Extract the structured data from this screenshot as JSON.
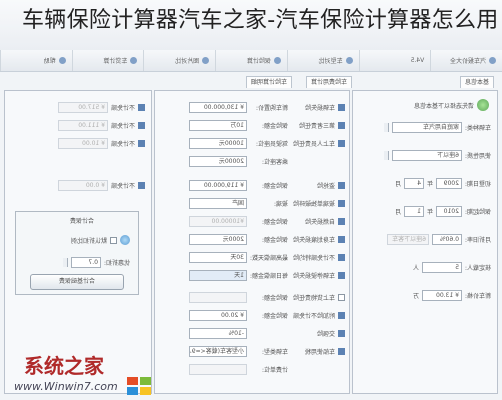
{
  "headline": "车辆保险计算器汽车之家-汽车保险计算器怎么用",
  "window": {
    "title": "车辆保险计算器"
  },
  "toolbar": {
    "items": [
      "汽车报价大全",
      "V4.5",
      "车型对比",
      "保险计算",
      "图片对比",
      "车贷计算",
      "帮助"
    ]
  },
  "tabs": {
    "left": "车险计算明细",
    "middle": "车险费用计算",
    "right": "基本信息"
  },
  "right_panel": {
    "header": "请先选择以下基本信息",
    "fields": [
      {
        "label": "车辆种类:",
        "value": "家庭自用汽车"
      },
      {
        "label": "使用性质:",
        "value": "6座以下"
      },
      {
        "label": "初登日期:",
        "value": "2009",
        "unit": "年",
        "month": "4",
        "month_unit": "月"
      },
      {
        "label": "保险起期:",
        "value": "2010",
        "unit": "年",
        "month": "1",
        "month_unit": "月"
      },
      {
        "label": "月折旧率:",
        "value": "0.60%",
        "extra": "6座以下客车"
      },
      {
        "label": "核定载人:",
        "value": "5",
        "unit": "人"
      },
      {
        "label": "新车价格:",
        "value": "¥ 13.00",
        "unit": "万"
      }
    ]
  },
  "middle_panel": {
    "rows": [
      {
        "label": "车辆损失险",
        "field_label": "新车购置价:",
        "value": "¥ 130,000.00"
      },
      {
        "label": "第三者责任险",
        "field_label": "保险金额:",
        "value": "10万"
      },
      {
        "label": "车上人员责任险",
        "field_label": "驾驶员座位:",
        "value": "10000元"
      },
      {
        "label": "",
        "field_label": "乘客座位:",
        "value": "20000元"
      },
      {
        "label": "盗抢险",
        "field_label": "保险金额:",
        "value": "¥ 119,000.00"
      },
      {
        "label": "玻璃单独破碎险",
        "field_label": "玻璃:",
        "value": "国产"
      },
      {
        "label": "自燃损失险",
        "field_label": "保险金额:",
        "value": "¥10000.00"
      },
      {
        "label": "车身划痕损失险",
        "field_label": "保险金额:",
        "value": "2000元"
      },
      {
        "label": "不计免赔特约险",
        "field_label": "最高赔偿天数:",
        "value": "30天"
      },
      {
        "label": "车辆停驶损失险",
        "field_label": "每日赔偿金额:",
        "value": "1天"
      },
      {
        "label": "车上货物责任险",
        "field_label": "保险金额:",
        "value": ""
      },
      {
        "label": "附加险不计免赔",
        "field_label": "保险金额:",
        "value": "¥ 20.00"
      },
      {
        "label": "交强险",
        "field_label": "",
        "value": "-10%"
      },
      {
        "label": "车船使用税",
        "field_label": "车辆类型:",
        "value": "小型客车(载客<=9人)"
      },
      {
        "label": "",
        "field_label": "计费单位:",
        "value": ""
      }
    ]
  },
  "left_panel": {
    "rows": [
      {
        "label": "不计免赔",
        "value": "¥ 517.00"
      },
      {
        "label": "不计免赔",
        "value": "¥ 111.00"
      },
      {
        "label": "不计免赔",
        "value": "¥ 10.00"
      },
      {
        "label": "不计免赔",
        "value": "¥ 0.00"
      }
    ],
    "group": {
      "title": "合计保费",
      "check_label": "默认折扣比例",
      "discount_label": "优惠折扣:",
      "discount_value": "0.7",
      "button": "合计基础保费"
    }
  },
  "watermark": {
    "cn": "系统之家",
    "url": "www.Winwin7.com"
  },
  "colors": {
    "accent": "#2f5f9e",
    "watermark_red": "#b02a2a",
    "panel_bg": "#f6f8fb"
  }
}
